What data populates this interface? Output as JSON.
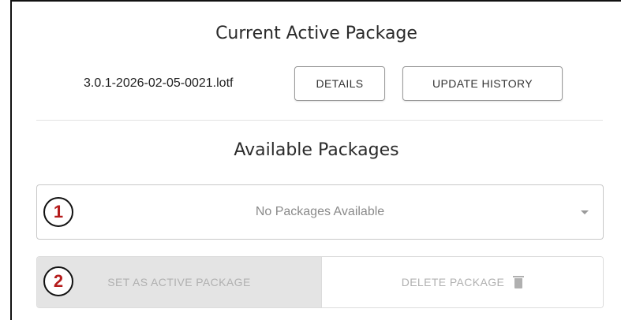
{
  "current": {
    "title": "Current Active Package",
    "package_name": "3.0.1-2026-02-05-0021.lotf",
    "details_label": "DETAILS",
    "update_history_label": "UPDATE HISTORY"
  },
  "available": {
    "title": "Available Packages",
    "select_value": "No Packages Available"
  },
  "actions": {
    "set_active_label": "SET AS ACTIVE PACKAGE",
    "delete_label": "DELETE PACKAGE"
  },
  "annotations": {
    "badge_1": "1",
    "badge_2": "2",
    "badge_color": "#b51c1c"
  },
  "icons": {
    "dropdown": "caret-down-icon",
    "delete": "trash-icon"
  }
}
